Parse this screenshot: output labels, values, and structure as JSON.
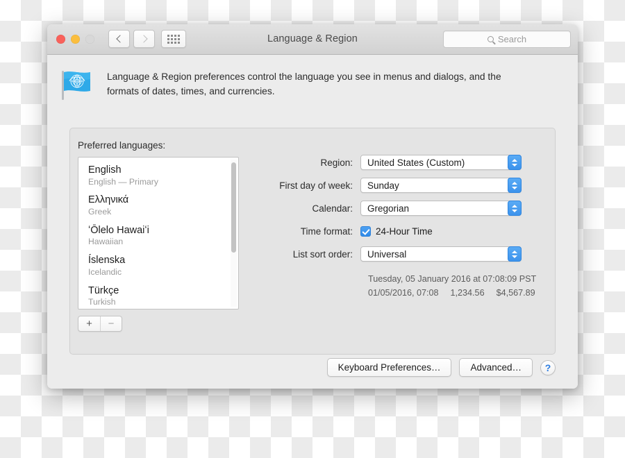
{
  "window": {
    "title": "Language & Region",
    "traffic_lights": [
      "close-button",
      "minimize-button",
      "zoom-button"
    ],
    "nav": {
      "back_icon": "chevron-left-icon",
      "forward_icon": "chevron-right-icon",
      "show_all_icon": "grid-icon"
    },
    "search": {
      "placeholder": "Search",
      "icon": "search-icon"
    }
  },
  "intro": {
    "icon": "un-flag-icon",
    "text": "Language & Region preferences control the language you see in menus and dialogs, and the formats of dates, times, and currencies."
  },
  "panel": {
    "label": "Preferred languages:",
    "languages": [
      {
        "name": "English",
        "sub": "English — Primary"
      },
      {
        "name": "Ελληνικά",
        "sub": "Greek"
      },
      {
        "name": "ʻŌlelo Hawaiʻi",
        "sub": "Hawaiian"
      },
      {
        "name": "Íslenska",
        "sub": "Icelandic"
      },
      {
        "name": "Türkçe",
        "sub": "Turkish"
      }
    ],
    "add_label": "+",
    "remove_label": "−"
  },
  "form": {
    "region": {
      "label": "Region:",
      "value": "United States (Custom)"
    },
    "first_day": {
      "label": "First day of week:",
      "value": "Sunday"
    },
    "calendar": {
      "label": "Calendar:",
      "value": "Gregorian"
    },
    "time_format": {
      "label": "Time format:",
      "checkbox_label": "24-Hour Time",
      "checked": true
    },
    "sort_order": {
      "label": "List sort order:",
      "value": "Universal"
    },
    "preview": {
      "line1": "Tuesday, 05 January 2016 at 07:08:09 PST",
      "date_short": "01/05/2016, 07:08",
      "number_sample": "1,234.56",
      "currency_sample": "$4,567.89"
    }
  },
  "footer": {
    "keyboard_prefs": "Keyboard Preferences…",
    "advanced": "Advanced…",
    "help": "?"
  },
  "colors": {
    "accent_blue": "#3d93ec",
    "window_bg": "#ececec",
    "panel_bg": "#e4e4e4",
    "help_blue": "#2b7ce0"
  }
}
